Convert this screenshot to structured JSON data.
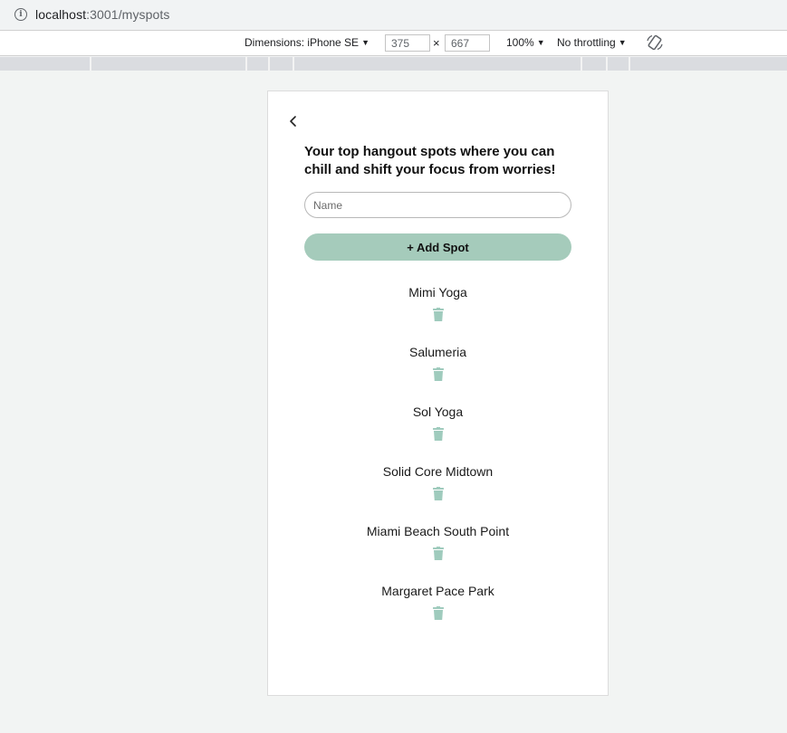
{
  "browser": {
    "url_host": "localhost",
    "url_path": ":3001/myspots"
  },
  "devtools": {
    "dimensions_label": "Dimensions: iPhone SE",
    "width": "375",
    "height": "667",
    "times": "×",
    "zoom": "100%",
    "throttling": "No throttling"
  },
  "app": {
    "back_icon": "chevron-left",
    "title": "Your top hangout spots where you can chill and shift your focus from worries!",
    "name_placeholder": "Name",
    "add_button_label": "+ Add Spot",
    "accent_color": "#a5cbbb",
    "trash_color": "#9fcbbd",
    "spots": [
      {
        "name": "Mimi Yoga"
      },
      {
        "name": "Salumeria"
      },
      {
        "name": "Sol Yoga"
      },
      {
        "name": "Solid Core Midtown"
      },
      {
        "name": "Miami Beach South Point"
      },
      {
        "name": "Margaret Pace Park"
      }
    ]
  }
}
